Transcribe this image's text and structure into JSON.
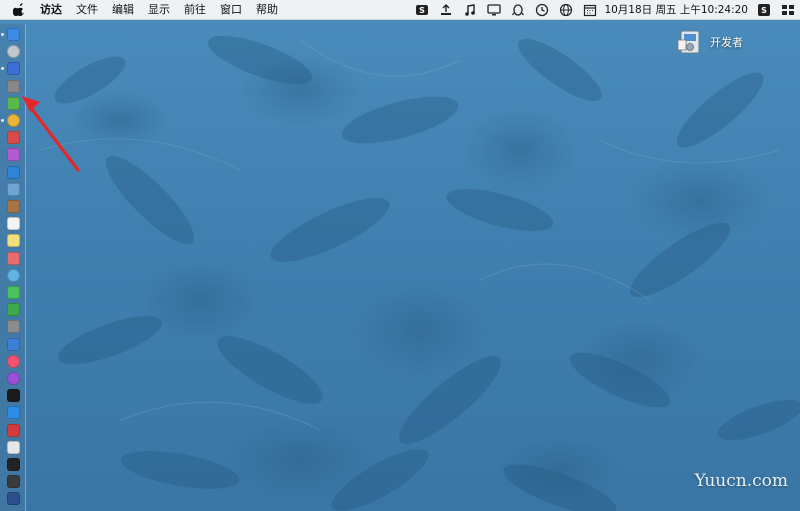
{
  "menubar": {
    "items": [
      "访达",
      "文件",
      "编辑",
      "显示",
      "前往",
      "窗口",
      "帮助"
    ],
    "datetime": "10月18日 周五 上午10:24:20",
    "status_icons": [
      "s-app-icon",
      "upload-icon",
      "music-note-icon",
      "monitor-icon",
      "qq-icon",
      "clock-icon",
      "globe-icon",
      "calendar-icon",
      "wechat-icon",
      "sogou-icon"
    ]
  },
  "desktop": {
    "item_label": "开发者",
    "watermark": "Yuucn.com"
  },
  "dock": {
    "apps": [
      {
        "name": "finder-icon",
        "color": "#3c8be6"
      },
      {
        "name": "launchpad-icon",
        "color": "#c0c7cf"
      },
      {
        "name": "safari-icon",
        "color": "#3b6fd4"
      },
      {
        "name": "rocket-icon",
        "color": "#888888"
      },
      {
        "name": "android-studio-icon",
        "color": "#5ab94a"
      },
      {
        "name": "chrome-icon",
        "color": "#e8b43a"
      },
      {
        "name": "red-app-icon",
        "color": "#d94b4b"
      },
      {
        "name": "purple-app-icon",
        "color": "#b55ad0"
      },
      {
        "name": "safari-blue-icon",
        "color": "#2f84d9"
      },
      {
        "name": "preview-icon",
        "color": "#6fa4d3"
      },
      {
        "name": "notes-brown-icon",
        "color": "#a77544"
      },
      {
        "name": "calendar-icon",
        "color": "#f4f4f4"
      },
      {
        "name": "notes-icon",
        "color": "#f3e07a"
      },
      {
        "name": "photos-icon",
        "color": "#e86d6d"
      },
      {
        "name": "maps-icon",
        "color": "#5fb4e0"
      },
      {
        "name": "messages-icon",
        "color": "#48c25a"
      },
      {
        "name": "facetime-icon",
        "color": "#3caa4a"
      },
      {
        "name": "system-settings-icon",
        "color": "#8c8c8c"
      },
      {
        "name": "keynote-icon",
        "color": "#3c7fd6"
      },
      {
        "name": "music-icon",
        "color": "#f25470"
      },
      {
        "name": "podcasts-icon",
        "color": "#9a50d8"
      },
      {
        "name": "apple-tv-icon",
        "color": "#1b1b1b"
      },
      {
        "name": "app-store-icon",
        "color": "#2b8de8"
      },
      {
        "name": "vivaldi-icon",
        "color": "#d63b3b"
      },
      {
        "name": "unknown-app-icon",
        "color": "#e7e7e7"
      },
      {
        "name": "terminal-icon",
        "color": "#222222"
      },
      {
        "name": "console-icon",
        "color": "#3a3a3a"
      },
      {
        "name": "vpn-icon",
        "color": "#2a4f8a"
      }
    ]
  }
}
